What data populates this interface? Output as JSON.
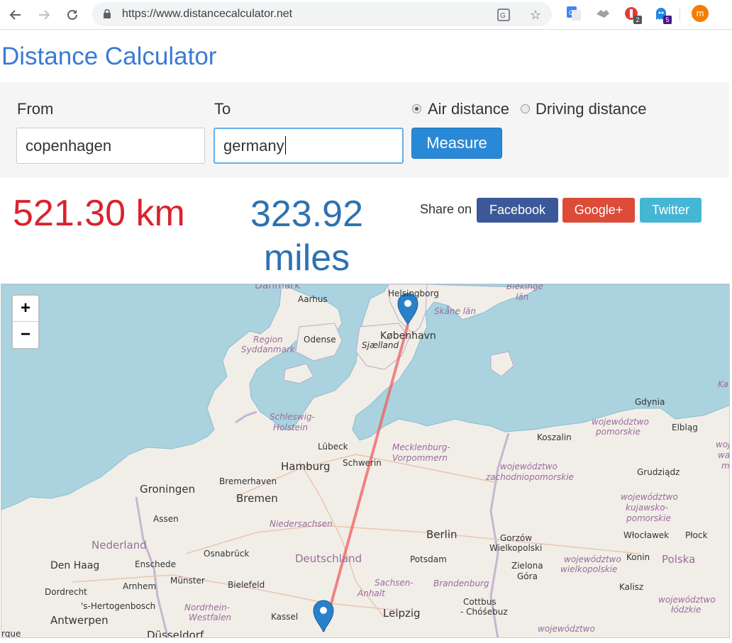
{
  "browser": {
    "url": "https://www.distancecalculator.net",
    "extensions": [
      {
        "icon": "google-translate-icon"
      },
      {
        "icon": "handshake-icon"
      },
      {
        "icon": "adblock-icon",
        "badge": "2"
      },
      {
        "icon": "ghost-icon",
        "badge": "5"
      }
    ],
    "profile_initial": "m"
  },
  "page": {
    "title": "Distance Calculator",
    "form": {
      "from_label": "From",
      "from_value": "copenhagen",
      "to_label": "To",
      "to_value": "germany",
      "air_label": "Air distance",
      "driving_label": "Driving distance",
      "selected_mode": "Air distance",
      "measure_label": "Measure"
    },
    "result": {
      "km": "521.30 km",
      "miles_value": "323.92",
      "miles_unit": "miles"
    },
    "share": {
      "label": "Share on",
      "facebook": "Facebook",
      "google": "Google+",
      "twitter": "Twitter",
      "colors": {
        "facebook": "#3b5998",
        "google": "#dd4b39",
        "twitter": "#45b6d3"
      }
    }
  },
  "map": {
    "zoom_in": "+",
    "zoom_out": "−",
    "labels": {
      "danmark": "Danmark",
      "aarhus": "Aarhus",
      "helsingborg": "Helsingborg",
      "blekinge": "Blekinge",
      "lan": "län",
      "skane": "Skåne län",
      "odense": "Odense",
      "kobenhavn": "København",
      "sjaelland": "Sjælland",
      "region": "Region",
      "syddanmark": "Syddanmark",
      "ka": "Ka",
      "gdynia": "Gdynia",
      "woj_pomorskie_1": "województwo",
      "woj_pomorskie_2": "pomorskie",
      "elblag": "Elbląg",
      "koszalin": "Koszalin",
      "schleswig": "Schleswig-",
      "holstein": "Holstein",
      "lubeck": "Lübeck",
      "mecklenburg": "Mecklenburg-",
      "vorpommern": "Vorpommern",
      "hamburg": "Hamburg",
      "schwerin": "Schwerin",
      "woj_zach_1": "województwo",
      "woj_zach_2": "zachodniopomorskie",
      "grudziadz": "Grudziądz",
      "groningen": "Groningen",
      "bremerhaven": "Bremerhaven",
      "bremen": "Bremen",
      "woj_kuj_1": "województwo",
      "woj_kuj_2": "kujawsko-",
      "woj_kuj_3": "pomorskie",
      "assen": "Assen",
      "niedersachsen": "Niedersachsen",
      "berlin": "Berlin",
      "gorzow": "Gorzów",
      "wielkopolski": "Wielkopolski",
      "wloclawek": "Włocławek",
      "plock": "Płock",
      "nederland": "Nederland",
      "osnabruck": "Osnabrück",
      "deutschland": "Deutschland",
      "potsdam": "Potsdam",
      "konin": "Konin",
      "polska": "Polska",
      "den_haag": "Den Haag",
      "enschede": "Enschede",
      "zielona": "Zielona",
      "gora": "Góra",
      "woj_wlkp_1": "województwo",
      "woj_wlkp_2": "wielkopolskie",
      "dordrecht": "Dordrecht",
      "arnhem": "Arnhem",
      "munster": "Münster",
      "bielefeld": "Bielefeld",
      "sachsen": "Sachsen-",
      "anhalt": "Anhalt",
      "brandenburg": "Brandenburg",
      "kalisz": "Kalisz",
      "hertogenbosch": "'s-Hertogenbosch",
      "nordrhein": "Nordrhein-",
      "westfalen": "Westfalen",
      "cottbus": "Cottbus",
      "chosebuz": "- Chóśebuz",
      "woj_lodz_1": "województwo",
      "woj_lodz_2": "łódzkie",
      "antwerpen": "Antwerpen",
      "kassel": "Kassel",
      "leipzig": "Leipzig",
      "woj_bottom": "województwo",
      "rque": "rque",
      "dusseldorf": "Düsseldorf",
      "wo_1": "woj",
      "wo_2": "wa",
      "wo_3": "m"
    }
  }
}
